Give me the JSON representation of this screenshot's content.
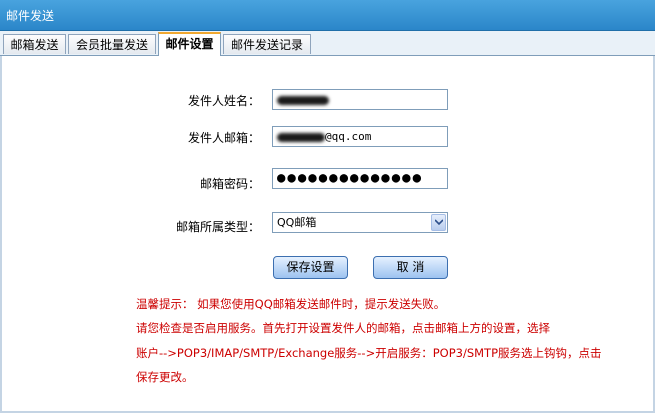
{
  "window": {
    "title": "邮件发送"
  },
  "tabs": [
    {
      "label": "邮箱发送"
    },
    {
      "label": "会员批量发送"
    },
    {
      "label": "邮件设置"
    },
    {
      "label": "邮件发送记录"
    }
  ],
  "form": {
    "sender_name": {
      "label": "发件人姓名："
    },
    "sender_email": {
      "label": "发件人邮箱：",
      "visible_suffix": "@qq.com"
    },
    "password": {
      "label": "邮箱密码：",
      "masked": "●●●●●●●●●●●●●●"
    },
    "mailbox_type": {
      "label": "邮箱所属类型：",
      "selected": "QQ邮箱"
    }
  },
  "buttons": {
    "save": "保存设置",
    "cancel": "取 消"
  },
  "tip": {
    "line1": "温馨提示： 如果您使用QQ邮箱发送邮件时，提示发送失败。",
    "line2": "请您检查是否启用服务。首先打开设置发件人的邮箱，点击邮箱上方的设置，选择",
    "line3": "账户-->POP3/IMAP/SMTP/Exchange服务-->开启服务：POP3/SMTP服务选上钩钩，点击",
    "line4": "保存更改。"
  }
}
